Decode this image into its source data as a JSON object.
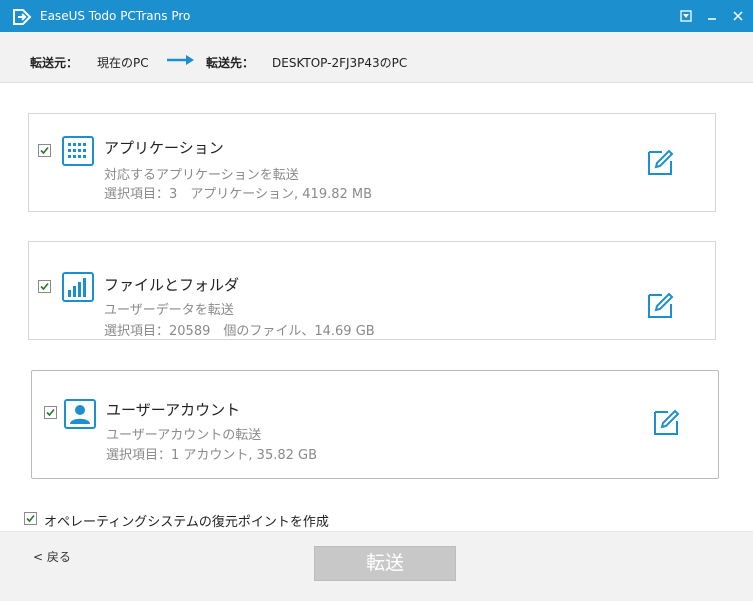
{
  "window": {
    "title": "EaseUS Todo PCTrans Pro"
  },
  "header": {
    "source_label": "転送元：",
    "source_value": "現在のPC",
    "dest_label": "転送先：",
    "dest_value": "DESKTOP-2FJ3P43のPC"
  },
  "cards": [
    {
      "title": "アプリケーション",
      "desc": "対応するアプリケーションを転送",
      "detail": "選択項目：3　アプリケーション, 419.82  MB",
      "checked": true,
      "icon": "apps-grid-icon"
    },
    {
      "title": "ファイルとフォルダ",
      "desc": "ユーザーデータを転送",
      "detail": "選択項目：20589　個のファイル、14.69  GB",
      "checked": true,
      "icon": "bar-chart-icon"
    },
    {
      "title": "ユーザーアカウント",
      "desc": "ユーザーアカウントの転送",
      "detail": "選択項目：1 アカウント, 35.82 GB",
      "checked": true,
      "icon": "user-account-icon"
    }
  ],
  "restore_point": {
    "label": "オペレーティングシステムの復元ポイントを作成",
    "checked": true
  },
  "footer": {
    "back_label": "< 戻る",
    "transfer_label": "転送"
  },
  "colors": {
    "accent": "#1c8fcf",
    "button_disabled": "#c8c8c8"
  }
}
